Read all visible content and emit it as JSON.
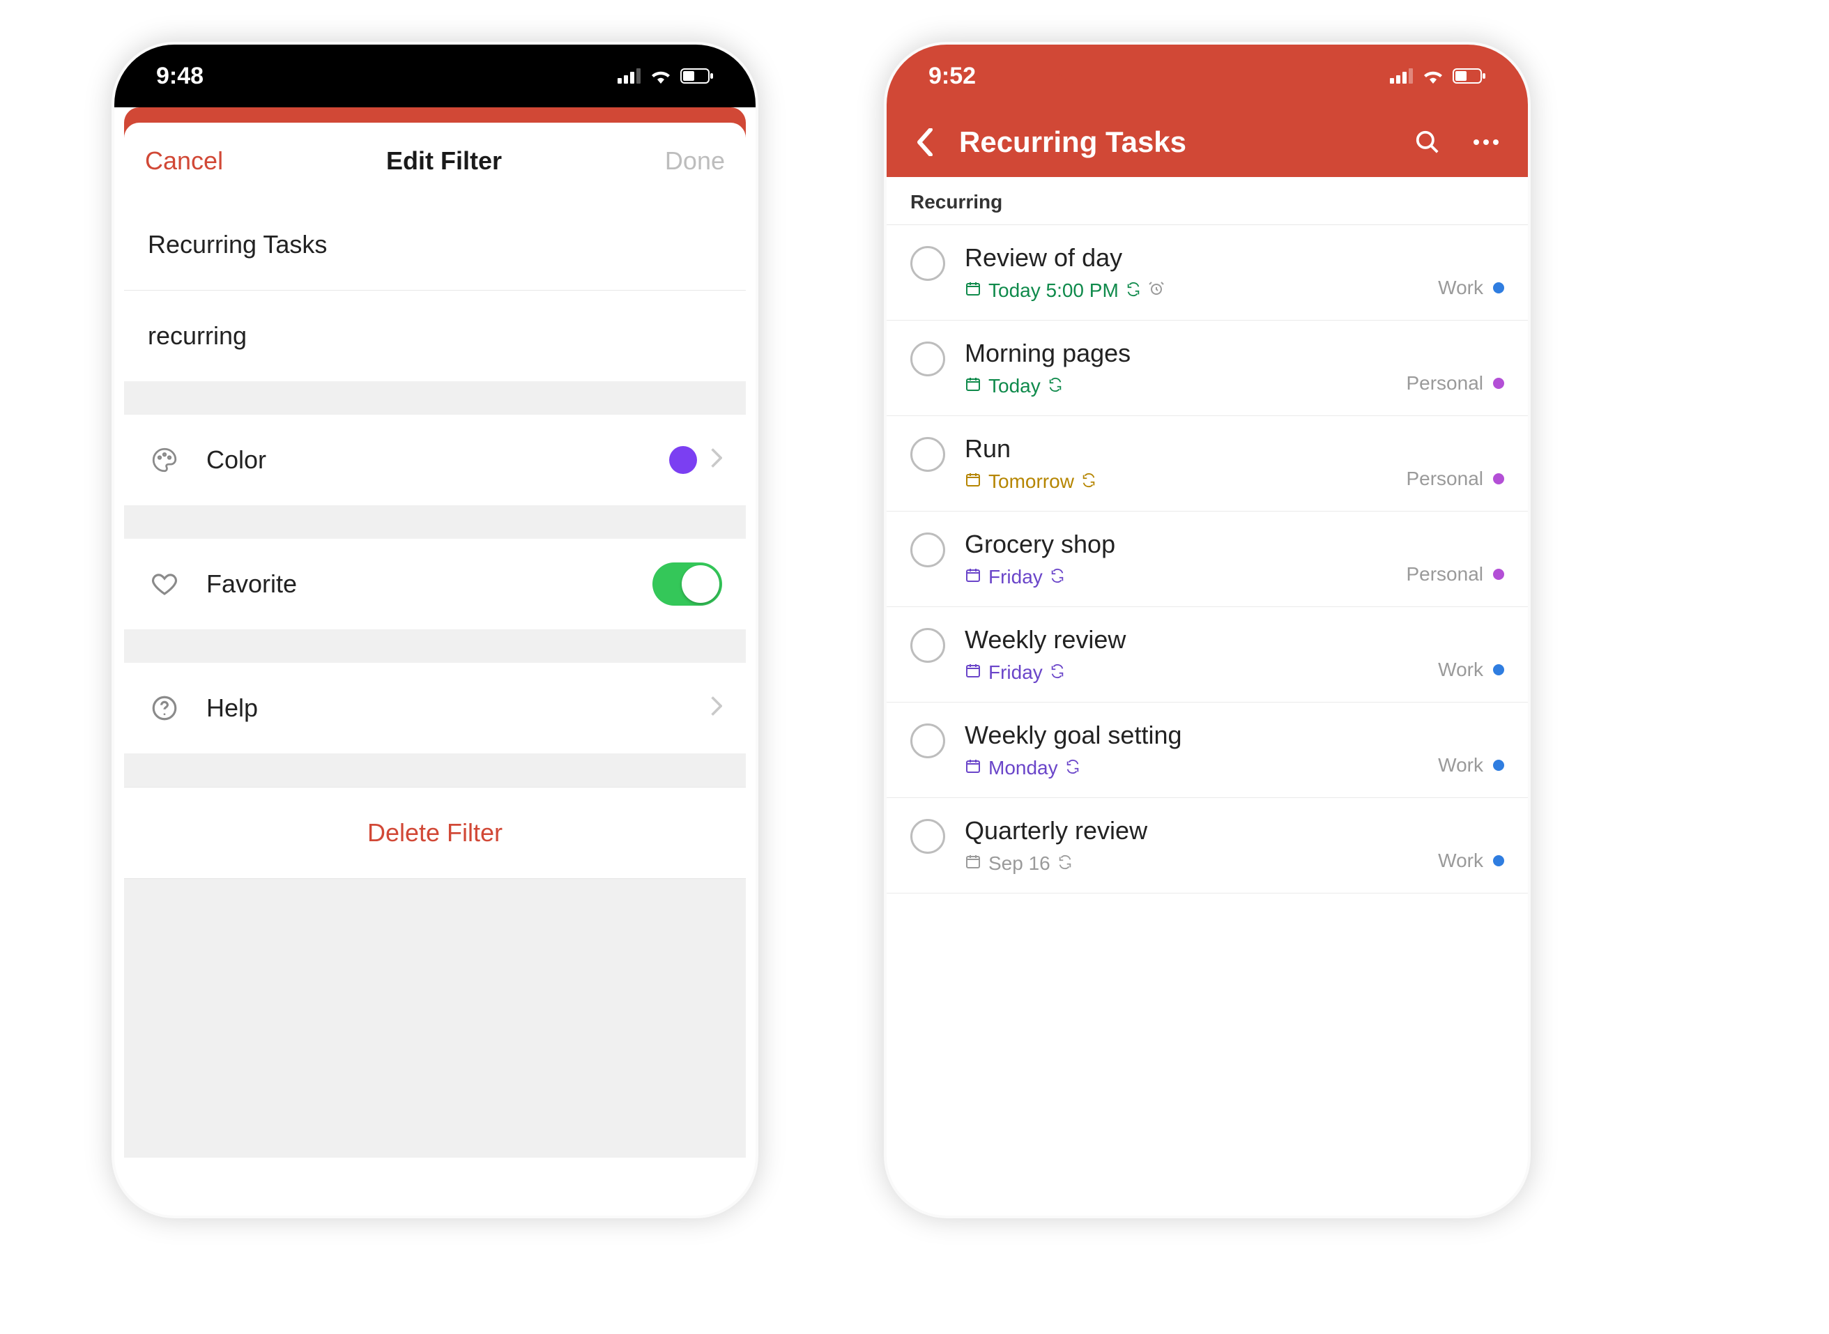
{
  "phone1": {
    "status_time": "9:48",
    "nav": {
      "cancel": "Cancel",
      "title": "Edit Filter",
      "done": "Done"
    },
    "filter_name": "Recurring Tasks",
    "filter_query": "recurring",
    "rows": {
      "color_label": "Color",
      "color_value": "#7b3ff2",
      "favorite_label": "Favorite",
      "favorite_on": true,
      "help_label": "Help"
    },
    "delete_label": "Delete Filter"
  },
  "phone2": {
    "status_time": "9:52",
    "header_title": "Recurring Tasks",
    "section_title": "Recurring",
    "tasks": [
      {
        "name": "Review of day",
        "date_text": "Today 5:00 PM",
        "date_color": "c-green",
        "has_alarm": true,
        "project": "Work",
        "project_color": "#2f7de0"
      },
      {
        "name": "Morning pages",
        "date_text": "Today",
        "date_color": "c-green",
        "has_alarm": false,
        "project": "Personal",
        "project_color": "#b34fd6"
      },
      {
        "name": "Run",
        "date_text": "Tomorrow",
        "date_color": "c-amber",
        "has_alarm": false,
        "project": "Personal",
        "project_color": "#b34fd6"
      },
      {
        "name": "Grocery shop",
        "date_text": "Friday",
        "date_color": "c-purple",
        "has_alarm": false,
        "project": "Personal",
        "project_color": "#b34fd6"
      },
      {
        "name": "Weekly review",
        "date_text": "Friday",
        "date_color": "c-purple",
        "has_alarm": false,
        "project": "Work",
        "project_color": "#2f7de0"
      },
      {
        "name": "Weekly goal setting",
        "date_text": "Monday",
        "date_color": "c-purple",
        "has_alarm": false,
        "project": "Work",
        "project_color": "#2f7de0"
      },
      {
        "name": "Quarterly review",
        "date_text": "Sep 16",
        "date_color": "c-grey",
        "has_alarm": false,
        "project": "Work",
        "project_color": "#2f7de0"
      }
    ]
  }
}
